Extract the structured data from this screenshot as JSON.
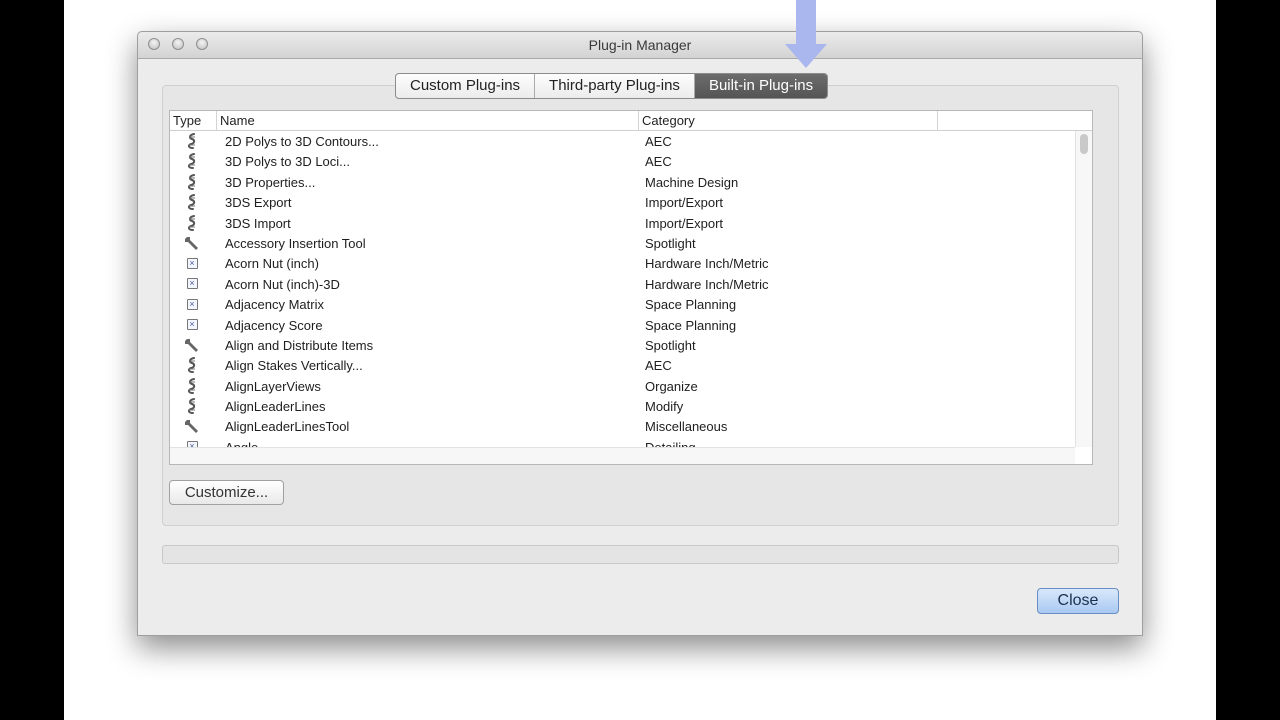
{
  "window": {
    "title": "Plug-in Manager"
  },
  "tabs": [
    {
      "label": "Custom Plug-ins",
      "selected": false
    },
    {
      "label": "Third-party Plug-ins",
      "selected": false
    },
    {
      "label": "Built-in Plug-ins",
      "selected": true
    }
  ],
  "table": {
    "columns": {
      "type": "Type",
      "name": "Name",
      "category": "Category"
    },
    "rows": [
      {
        "icon": "script-icon",
        "name": "2D Polys to 3D Contours...",
        "category": "AEC"
      },
      {
        "icon": "script-icon",
        "name": "3D Polys to 3D Loci...",
        "category": "AEC"
      },
      {
        "icon": "script-icon",
        "name": "3D Properties...",
        "category": "Machine Design"
      },
      {
        "icon": "script-icon",
        "name": "3DS Export",
        "category": "Import/Export"
      },
      {
        "icon": "script-icon",
        "name": "3DS Import",
        "category": "Import/Export"
      },
      {
        "icon": "wrench-icon",
        "name": "Accessory Insertion Tool",
        "category": "Spotlight"
      },
      {
        "icon": "object-icon",
        "name": "Acorn Nut (inch)",
        "category": "Hardware Inch/Metric"
      },
      {
        "icon": "object-icon",
        "name": "Acorn Nut (inch)-3D",
        "category": "Hardware Inch/Metric"
      },
      {
        "icon": "object-icon",
        "name": "Adjacency Matrix",
        "category": "Space Planning"
      },
      {
        "icon": "object-icon",
        "name": "Adjacency Score",
        "category": "Space Planning"
      },
      {
        "icon": "wrench-icon",
        "name": "Align and Distribute Items",
        "category": "Spotlight"
      },
      {
        "icon": "script-icon",
        "name": "Align Stakes Vertically...",
        "category": "AEC"
      },
      {
        "icon": "script-icon",
        "name": "AlignLayerViews",
        "category": "Organize"
      },
      {
        "icon": "script-icon",
        "name": "AlignLeaderLines",
        "category": "Modify"
      },
      {
        "icon": "wrench-icon",
        "name": "AlignLeaderLinesTool",
        "category": "Miscellaneous"
      },
      {
        "icon": "object-icon",
        "name": "Angle",
        "category": "Detailing"
      }
    ]
  },
  "buttons": {
    "customize": "Customize...",
    "close": "Close"
  },
  "colors": {
    "selected_tab": "#5e5e5e",
    "default_button": "#a9c9f2",
    "pointer_arrow": "#aab6ee"
  }
}
